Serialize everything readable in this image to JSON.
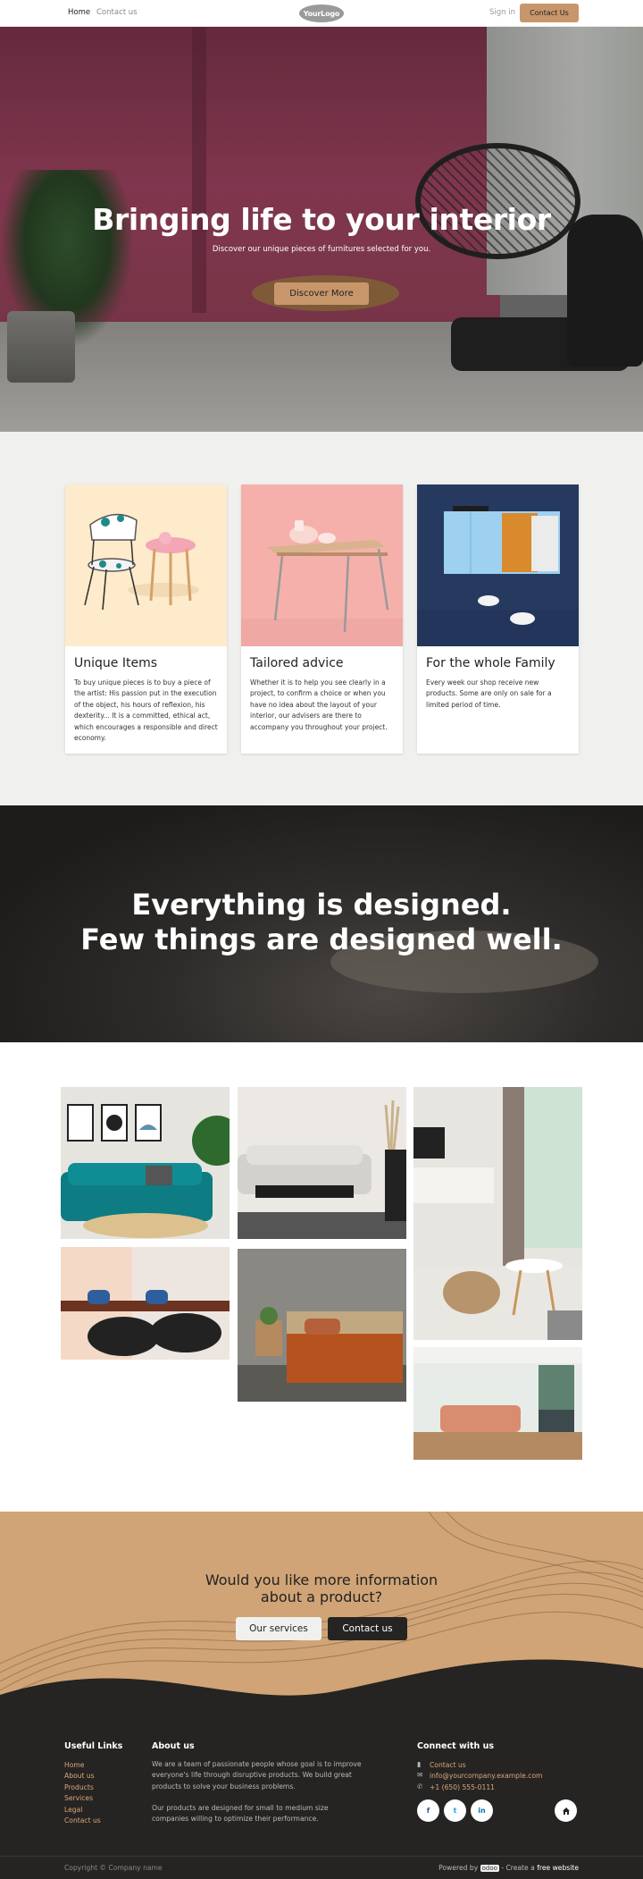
{
  "header": {
    "nav": [
      "Home",
      "Contact us"
    ],
    "logo": "YourLogo",
    "signin": "Sign in",
    "cta": "Contact Us"
  },
  "hero": {
    "title": "Bringing life to your interior",
    "subtitle": "Discover our unique pieces of furnitures selected for you.",
    "button": "Discover More"
  },
  "features": [
    {
      "title": "Unique Items",
      "text": "To buy unique pieces is to buy a piece of the artist: His passion put in the execution of the object, his hours of reflexion, his dexterity... It is a committed, ethical act, which encourages a responsible and direct economy."
    },
    {
      "title": "Tailored advice",
      "text": "Whether it is to help you see clearly in a project, to confirm a choice or when you have no idea about the layout of your interior, our advisers are there to accompany you throughout your project."
    },
    {
      "title": "For the whole Family",
      "text": "Every week our shop receive new products. Some are only on sale for a limited period of time."
    }
  ],
  "quote": {
    "line1": "Everything is designed.",
    "line2": "Few things are designed well."
  },
  "cta": {
    "question_line1": "Would you like more information",
    "question_line2": "about a product?",
    "button_primary": "Our services",
    "button_secondary": "Contact us"
  },
  "footer": {
    "useful_links_title": "Useful Links",
    "useful_links": [
      "Home",
      "About us",
      "Products",
      "Services",
      "Legal",
      "Contact us"
    ],
    "about_title": "About us",
    "about_p1": "We are a team of passionate people whose goal is to improve everyone's life through disruptive products. We build great products to solve your business problems.",
    "about_p2": "Our products are designed for small to medium size companies willing to optimize their performance.",
    "connect_title": "Connect with us",
    "contact_link": "Contact us",
    "email": "info@yourcompany.example.com",
    "phone": "+1 (650) 555-0111",
    "social": [
      "f",
      "t",
      "in"
    ],
    "home_icon": "home-icon"
  },
  "copyright": {
    "left": "Copyright © Company name",
    "powered": "Powered by",
    "odoo": "odoo",
    "create": " - Create a ",
    "free": "free website"
  },
  "colors": {
    "accent": "#c8966b",
    "dark": "#252422",
    "band": "#d0a476",
    "light_bg": "#f0f0ee"
  }
}
